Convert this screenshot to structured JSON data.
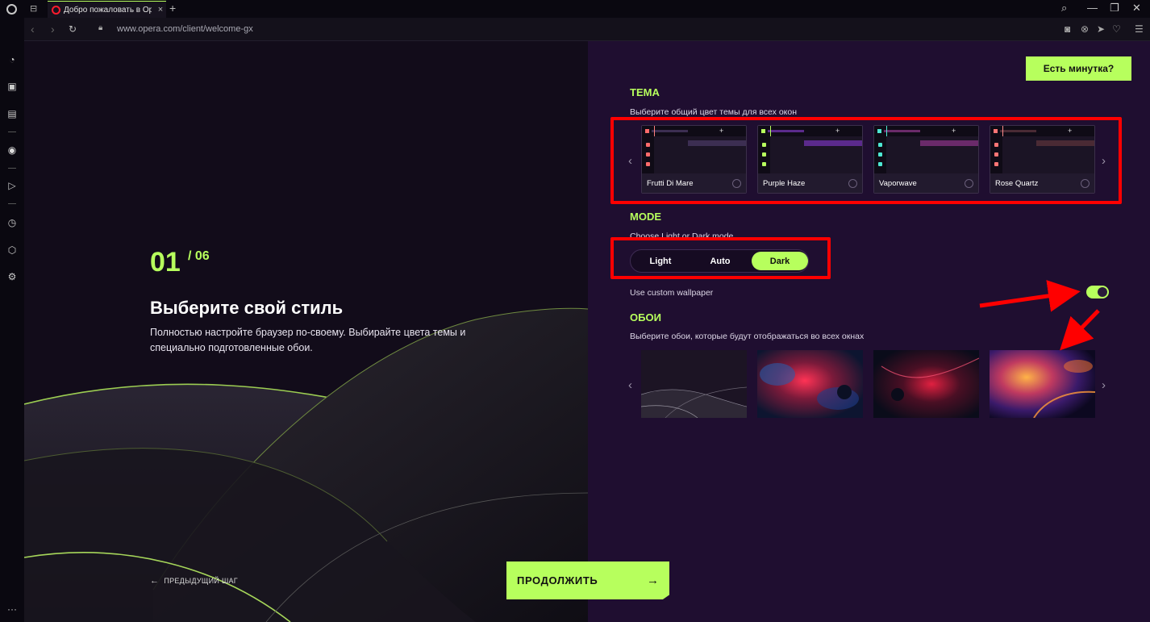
{
  "browser": {
    "tab_title": "Добро пожаловать в Ope",
    "url": "www.opera.com/client/welcome-gx"
  },
  "hero": {
    "step_current": "01",
    "step_total": "/ 06",
    "title": "Выберите свой стиль",
    "description": "Полностью настройте браузер по-своему. Выбирайте цвета темы и специально подготовленные обои.",
    "prev_step": "ПРЕДЫДУЩИЙ ШАГ",
    "continue_label": "ПРОДОЛЖИТЬ"
  },
  "panel": {
    "minute_button": "Есть минутка?",
    "theme": {
      "heading": "ТЕМА",
      "subtitle": "Выберите общий цвет темы для всех окон",
      "items": [
        {
          "name": "Frutti Di Mare",
          "accent": "#ff7f7f",
          "dot": "#ff6b6b",
          "bar": "#3c2e52"
        },
        {
          "name": "Purple Haze",
          "accent": "#b7ff5d",
          "dot": "#b7ff5d",
          "bar": "#5b2a8c"
        },
        {
          "name": "Vaporwave",
          "accent": "#4de8d2",
          "dot": "#4de8d2",
          "bar": "#6a2a6a"
        },
        {
          "name": "Rose Quartz",
          "accent": "#ff8a8a",
          "dot": "#ff7575",
          "bar": "#4a2a34"
        }
      ]
    },
    "mode": {
      "heading": "MODE",
      "subtitle": "Choose Light or Dark mode",
      "options": [
        "Light",
        "Auto",
        "Dark"
      ],
      "selected": "Dark"
    },
    "wallpaper_toggle": {
      "label": "Use custom wallpaper",
      "on": true
    },
    "wallpapers": {
      "heading": "ОБОИ",
      "subtitle": "Выберите обои, которые будут отображаться во всех окнах"
    }
  },
  "colors": {
    "accent": "#b7ff5d",
    "panel_bg": "#1f0e30",
    "annotation": "#ff0000"
  }
}
